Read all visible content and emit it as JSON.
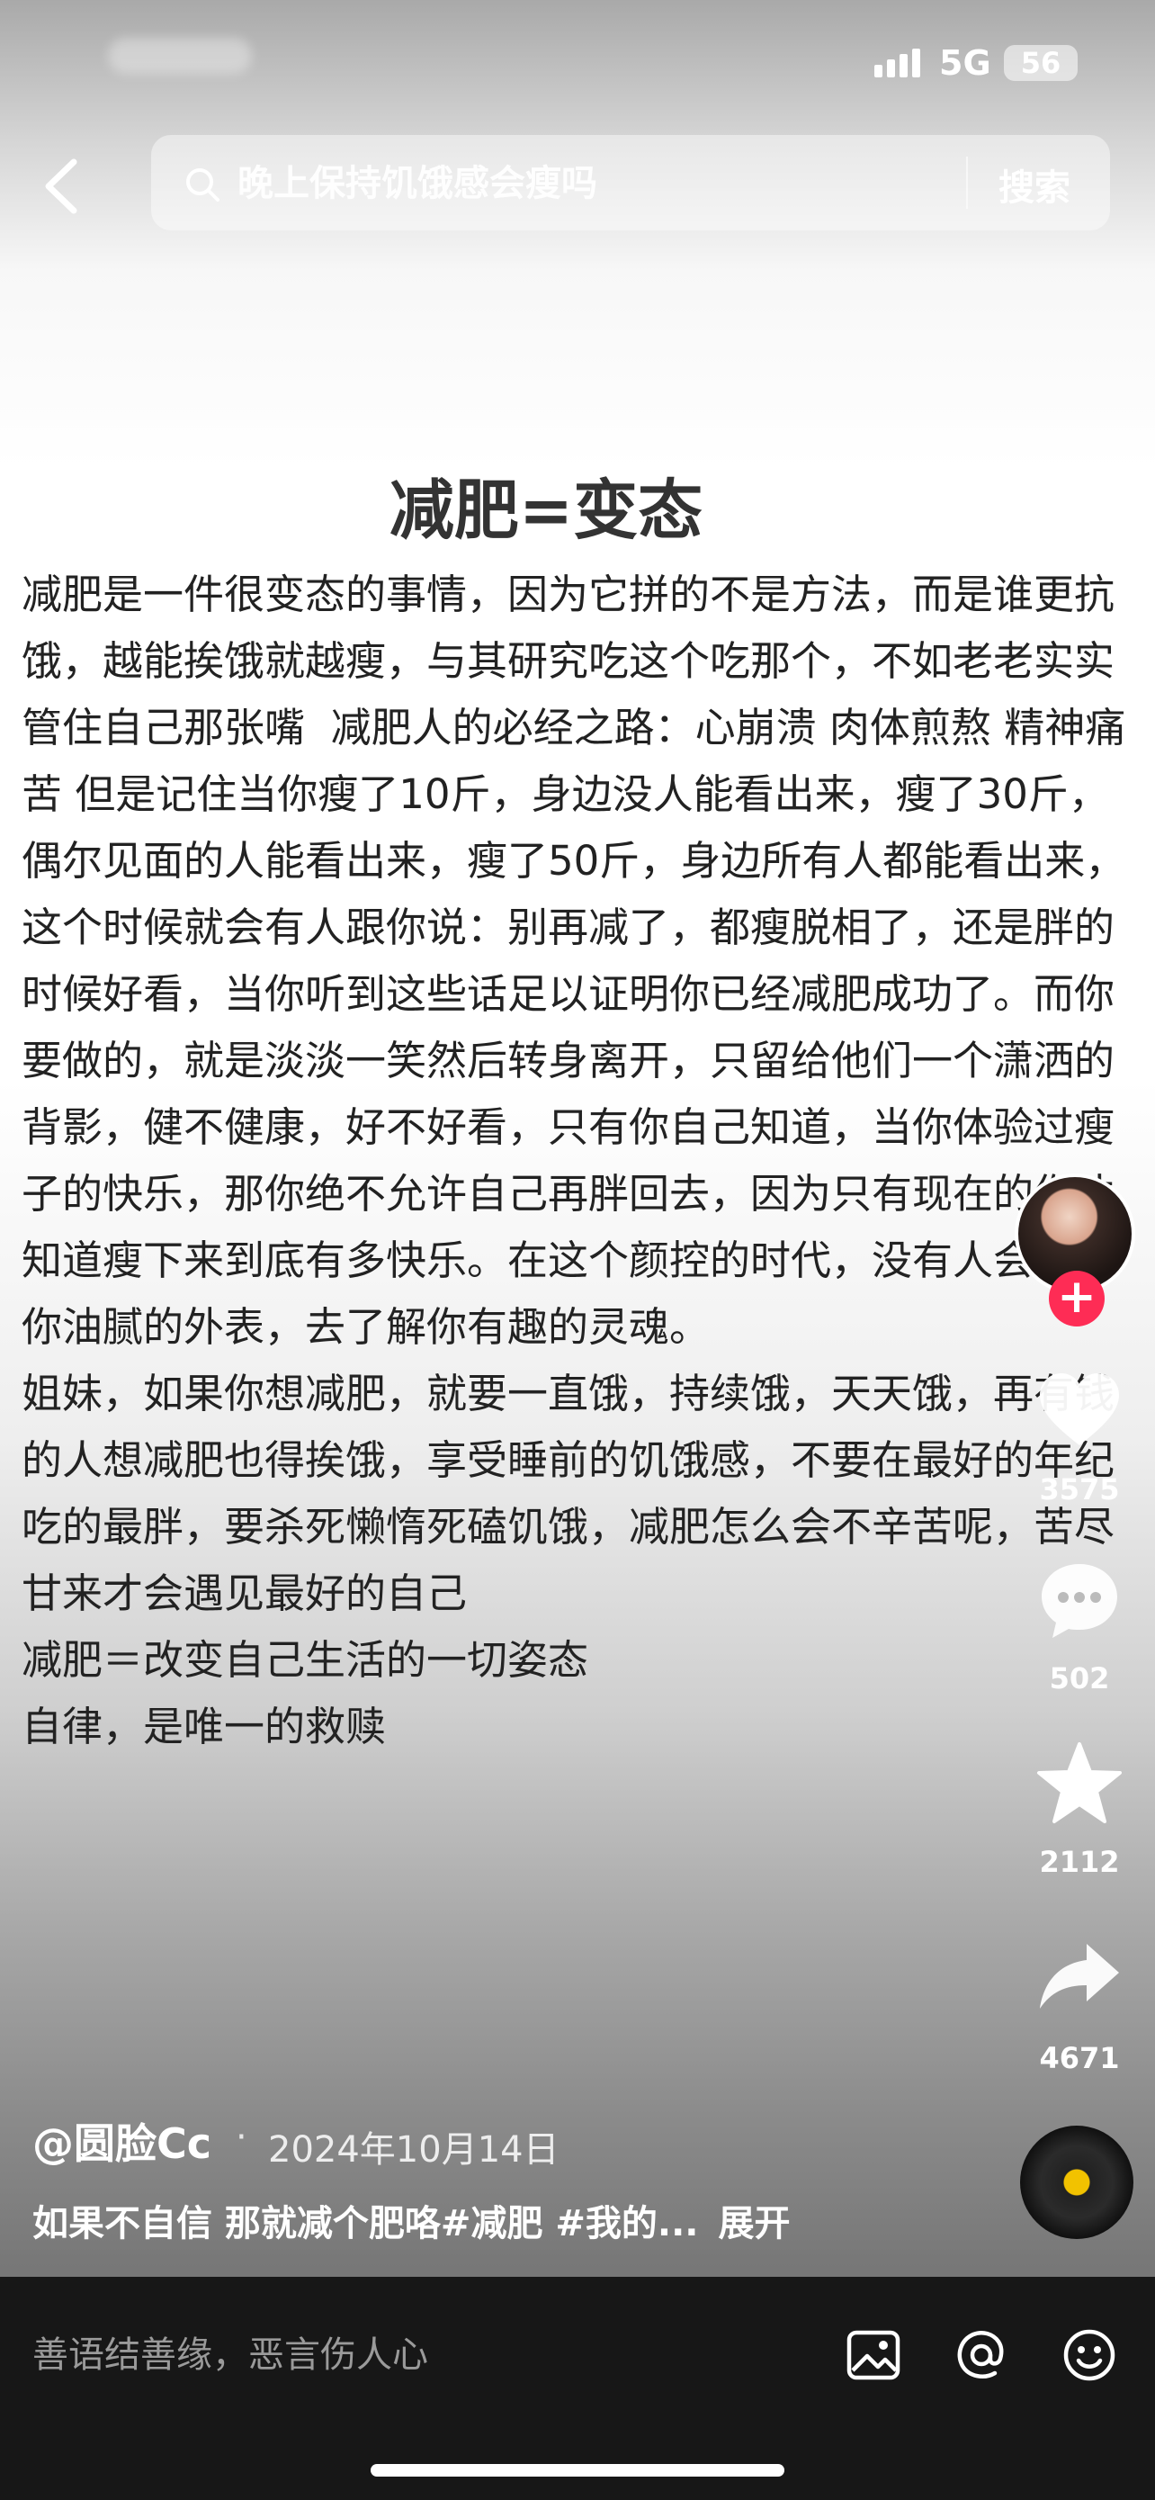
{
  "status_bar": {
    "network": "5G",
    "battery": "56"
  },
  "search": {
    "placeholder": "晚上保持饥饿感会瘦吗",
    "button_label": "搜索"
  },
  "article": {
    "title": "减肥=变态",
    "paragraphs": [
      "减肥是一件很变态的事情，因为它拼的不是方法，而是谁更抗饿，越能挨饿就越瘦，与其研究吃这个吃那个，不如老老实实管住自己那张嘴  减肥人的必经之路：心崩溃 肉体煎熬 精神痛苦 但是记住当你瘦了10斤，身边没人能看出来，瘦了30斤，偶尔见面的人能看出来，瘦了50斤，身边所有人都能看出来，这个时候就会有人跟你说：别再减了，都瘦脱相了，还是胖的时候好看，当你听到这些话足以证明你已经减肥成功了。而你要做的，就是淡淡一笑然后转身离开，只留给他们一个潇洒的背影，健不健康，好不好看，只有你自己知道，当你体验过瘦子的快乐，那你绝不允许自己再胖回去，因为只有现在的你才知道瘦下来到底有多快乐。在这个颜控的时代，没有人会通过你油腻的外表，去了解你有趣的灵魂。",
      "姐妹，如果你想减肥，就要一直饿，持续饿，天天饿，再有钱的人想减肥也得挨饿，享受睡前的饥饿感，不要在最好的年纪吃的最胖，要杀死懒惰死磕饥饿，减肥怎么会不辛苦呢，苦尽甘来才会遇见最好的自己",
      "减肥＝改变自己生活的一切姿态",
      "自律，是唯一的救赎"
    ]
  },
  "sidebar": {
    "like_count": "3575",
    "comment_count": "502",
    "favorite_count": "2112",
    "share_count": "4671"
  },
  "post": {
    "author": "@圆脸Cc",
    "separator": "·",
    "date": "2024年10月14日",
    "caption": "如果不自信 那就减个肥咯#减肥 #我的...",
    "expand_label": "展开"
  },
  "comment_bar": {
    "placeholder": "善语结善缘，恶言伤人心"
  },
  "colors": {
    "follow": "#fe2c55",
    "disc_center": "#f2c200",
    "bottom_bar": "#171717"
  }
}
